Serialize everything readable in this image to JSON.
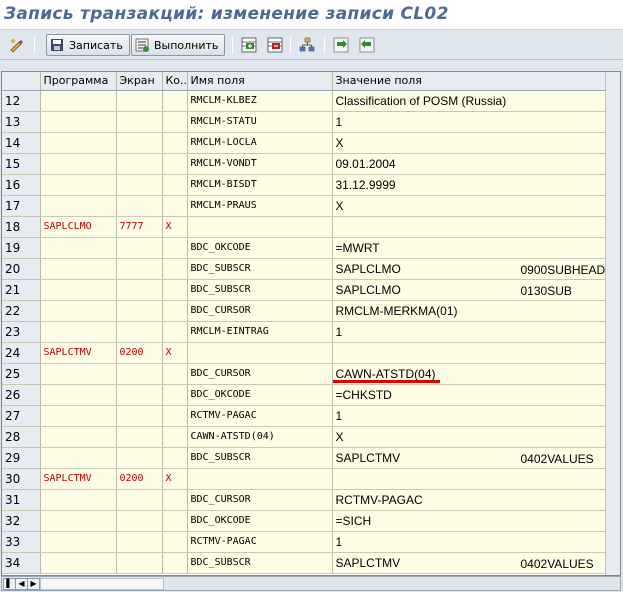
{
  "window": {
    "title": "Запись транзакций: изменение записи CL02"
  },
  "toolbar": {
    "save_label": "Записать",
    "execute_label": "Выполнить"
  },
  "grid": {
    "headers": [
      "",
      "Программа",
      "Экран",
      "Ко...",
      "Имя поля",
      "Значение поля"
    ],
    "rows": [
      {
        "n": "12",
        "prog": "",
        "screen": "",
        "start": "",
        "field": "RMCLM-KLBEZ",
        "value": "Classification of POSM (Russia)",
        "value2": ""
      },
      {
        "n": "13",
        "prog": "",
        "screen": "",
        "start": "",
        "field": "RMCLM-STATU",
        "value": "1",
        "value2": ""
      },
      {
        "n": "14",
        "prog": "",
        "screen": "",
        "start": "",
        "field": "RMCLM-LOCLA",
        "value": "X",
        "value2": ""
      },
      {
        "n": "15",
        "prog": "",
        "screen": "",
        "start": "",
        "field": "RMCLM-VONDT",
        "value": "09.01.2004",
        "value2": ""
      },
      {
        "n": "16",
        "prog": "",
        "screen": "",
        "start": "",
        "field": "RMCLM-BISDT",
        "value": "31.12.9999",
        "value2": ""
      },
      {
        "n": "17",
        "prog": "",
        "screen": "",
        "start": "",
        "field": "RMCLM-PRAUS",
        "value": "X",
        "value2": ""
      },
      {
        "n": "18",
        "prog": "SAPLCLMO",
        "screen": "7777",
        "start": "X",
        "field": "",
        "value": "",
        "value2": ""
      },
      {
        "n": "19",
        "prog": "",
        "screen": "",
        "start": "",
        "field": "BDC_OKCODE",
        "value": "=MWRT",
        "value2": ""
      },
      {
        "n": "20",
        "prog": "",
        "screen": "",
        "start": "",
        "field": "BDC_SUBSCR",
        "value": "SAPLCLMO",
        "value2": "0900SUBHEAD"
      },
      {
        "n": "21",
        "prog": "",
        "screen": "",
        "start": "",
        "field": "BDC_SUBSCR",
        "value": "SAPLCLMO",
        "value2": "0130SUB"
      },
      {
        "n": "22",
        "prog": "",
        "screen": "",
        "start": "",
        "field": "BDC_CURSOR",
        "value": "RMCLM-MERKMA(01)",
        "value2": ""
      },
      {
        "n": "23",
        "prog": "",
        "screen": "",
        "start": "",
        "field": "RMCLM-EINTRAG",
        "value": "1",
        "value2": ""
      },
      {
        "n": "24",
        "prog": "SAPLCTMV",
        "screen": "0200",
        "start": "X",
        "field": "",
        "value": "",
        "value2": ""
      },
      {
        "n": "25",
        "prog": "",
        "screen": "",
        "start": "",
        "field": "BDC_CURSOR",
        "value": "CAWN-ATSTD(04)",
        "value2": ""
      },
      {
        "n": "26",
        "prog": "",
        "screen": "",
        "start": "",
        "field": "BDC_OKCODE",
        "value": "=CHKSTD",
        "value2": ""
      },
      {
        "n": "27",
        "prog": "",
        "screen": "",
        "start": "",
        "field": "RCTMV-PAGAC",
        "value": "1",
        "value2": ""
      },
      {
        "n": "28",
        "prog": "",
        "screen": "",
        "start": "",
        "field": "CAWN-ATSTD(04)",
        "value": "X",
        "value2": ""
      },
      {
        "n": "29",
        "prog": "",
        "screen": "",
        "start": "",
        "field": "BDC_SUBSCR",
        "value": "SAPLCTMV",
        "value2": "0402VALUES"
      },
      {
        "n": "30",
        "prog": "SAPLCTMV",
        "screen": "0200",
        "start": "X",
        "field": "",
        "value": "",
        "value2": ""
      },
      {
        "n": "31",
        "prog": "",
        "screen": "",
        "start": "",
        "field": "BDC_CURSOR",
        "value": "RCTMV-PAGAC",
        "value2": ""
      },
      {
        "n": "32",
        "prog": "",
        "screen": "",
        "start": "",
        "field": "BDC_OKCODE",
        "value": "=SICH",
        "value2": ""
      },
      {
        "n": "33",
        "prog": "",
        "screen": "",
        "start": "",
        "field": "RCTMV-PAGAC",
        "value": "1",
        "value2": ""
      },
      {
        "n": "34",
        "prog": "",
        "screen": "",
        "start": "",
        "field": "BDC_SUBSCR",
        "value": "SAPLCTMV",
        "value2": "0402VALUES"
      }
    ]
  },
  "colors": {
    "title": "#4c6a94",
    "cell_bg": "#fdfde6",
    "red_text": "#b40000",
    "highlight": "#e00000"
  },
  "icons": [
    "edit-icon",
    "save-icon",
    "execute-icon",
    "insert-row-icon",
    "delete-row-icon",
    "hierarchy-icon",
    "next-icon",
    "previous-icon"
  ]
}
